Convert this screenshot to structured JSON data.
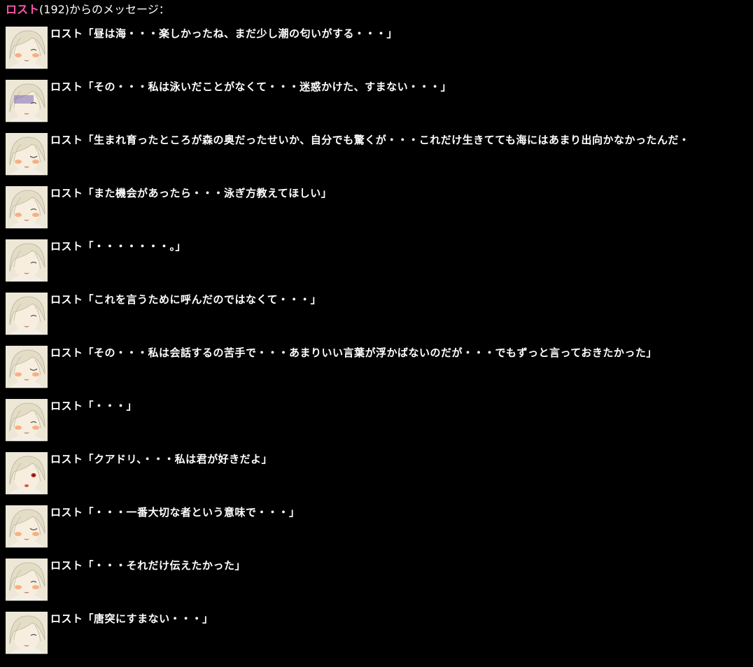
{
  "header": {
    "sender_name": "ロスト",
    "sender_id": "(192)",
    "suffix": "からのメッセージ："
  },
  "colors": {
    "background": "#000000",
    "sender_name": "#ff55a8",
    "text": "#ffffff"
  },
  "messages": [
    {
      "speaker": "ロスト",
      "text": "「昼は海・・・楽しかったね、まだ少し潮の匂いがする・・・」",
      "avatar": "portrait-smile-icon"
    },
    {
      "speaker": "ロスト",
      "text": "「その・・・私は泳いだことがなくて・・・迷惑かけた、すまない・・・」",
      "avatar": "portrait-gloomy-icon"
    },
    {
      "speaker": "ロスト",
      "text": "「生まれ育ったところが森の奥だったせいか、自分でも驚くが・・・これだけ生きてても海にはあまり出向かなかったんだ・",
      "avatar": "portrait-wink-icon"
    },
    {
      "speaker": "ロスト",
      "text": "「また機会があったら・・・泳ぎ方教えてほしい」",
      "avatar": "portrait-shy-icon"
    },
    {
      "speaker": "ロスト",
      "text": "「・・・・・・・。」",
      "avatar": "portrait-closed-eyes-icon"
    },
    {
      "speaker": "ロスト",
      "text": "「これを言うために呼んだのではなくて・・・」",
      "avatar": "portrait-closed-eyes-icon"
    },
    {
      "speaker": "ロスト",
      "text": "「その・・・私は会話するの苦手で・・・あまりいい言葉が浮かばないのだが・・・でもずっと言っておきたかった」",
      "avatar": "portrait-wink-blush-icon"
    },
    {
      "speaker": "ロスト",
      "text": "「・・・」",
      "avatar": "portrait-blush-icon"
    },
    {
      "speaker": "ロスト",
      "text": "「クアドリ、・・・私は君が好きだよ」",
      "avatar": "portrait-open-eye-icon"
    },
    {
      "speaker": "ロスト",
      "text": "「・・・一番大切な者という意味で・・・」",
      "avatar": "portrait-wink-blush-icon"
    },
    {
      "speaker": "ロスト",
      "text": "「・・・それだけ伝えたかった」",
      "avatar": "portrait-smile-blush-icon"
    },
    {
      "speaker": "ロスト",
      "text": "「唐突にすまない・・・」",
      "avatar": "portrait-neutral-icon"
    }
  ]
}
